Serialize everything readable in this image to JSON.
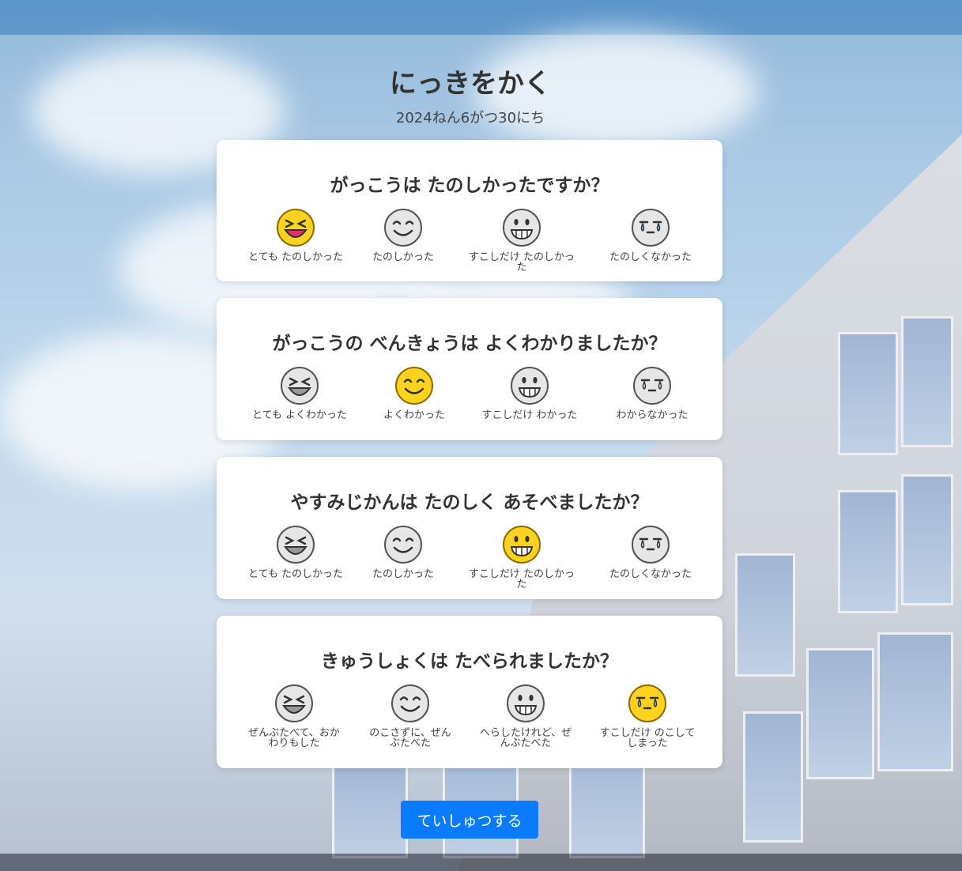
{
  "page": {
    "title": "にっきをかく",
    "date": "2024ねん6がつ30にち"
  },
  "questions": [
    {
      "question": "がっこうは たのしかったですか？",
      "options": [
        {
          "label": "とても たのしかった",
          "icon": "laughing-face-icon",
          "selected": true
        },
        {
          "label": "たのしかった",
          "icon": "smiling-face-icon",
          "selected": false
        },
        {
          "label": "すこしだけ たのしかった",
          "icon": "grinning-face-icon",
          "selected": false
        },
        {
          "label": "たのしくなかった",
          "icon": "crying-face-icon",
          "selected": false
        }
      ]
    },
    {
      "question": "がっこうの べんきょうは よくわかりましたか？",
      "options": [
        {
          "label": "とても よくわかった",
          "icon": "laughing-face-icon",
          "selected": false
        },
        {
          "label": "よくわかった",
          "icon": "smiling-face-icon",
          "selected": true
        },
        {
          "label": "すこしだけ わかった",
          "icon": "grinning-face-icon",
          "selected": false
        },
        {
          "label": "わからなかった",
          "icon": "crying-face-icon",
          "selected": false
        }
      ]
    },
    {
      "question": "やすみじかんは たのしく あそべましたか？",
      "options": [
        {
          "label": "とても たのしかった",
          "icon": "laughing-face-icon",
          "selected": false
        },
        {
          "label": "たのしかった",
          "icon": "smiling-face-icon",
          "selected": false
        },
        {
          "label": "すこしだけ たのしかった",
          "icon": "grinning-face-icon",
          "selected": true
        },
        {
          "label": "たのしくなかった",
          "icon": "crying-face-icon",
          "selected": false
        }
      ]
    },
    {
      "question": "きゅうしょくは たべられましたか？",
      "options": [
        {
          "label": "ぜんぶたべて、おかわりもした",
          "icon": "laughing-face-icon",
          "selected": false
        },
        {
          "label": "のこさずに、ぜんぶたべた",
          "icon": "smiling-face-icon",
          "selected": false
        },
        {
          "label": "へらしたけれど、ぜんぶたべた",
          "icon": "grinning-face-icon",
          "selected": false
        },
        {
          "label": "すこしだけ のこしてしまった",
          "icon": "crying-face-icon",
          "selected": true
        }
      ]
    }
  ],
  "submit": {
    "label": "ていしゅつする"
  },
  "colors": {
    "accent": "#0a7bff",
    "selected_face": "#ffd21f",
    "unselected_face": "#e6e6e6"
  }
}
